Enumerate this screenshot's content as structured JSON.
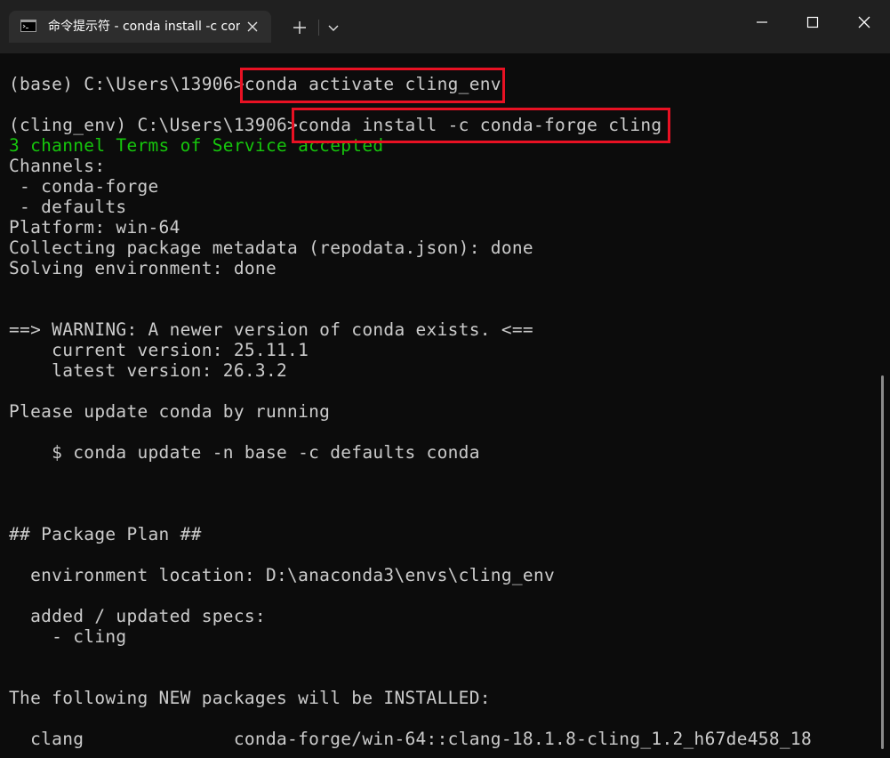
{
  "window": {
    "tab_title": "命令提示符 - conda  install -c conda-forge cling",
    "icons": {
      "tab_icon": "cmd-terminal-icon",
      "tab_close": "close-icon",
      "new_tab": "plus-icon",
      "dropdown": "chevron-down-icon",
      "minimize": "minimize-icon",
      "maximize": "maximize-icon",
      "close": "close-icon"
    }
  },
  "colors": {
    "background": "#0c0c0c",
    "titlebar": "#202020",
    "tab": "#2d2d2d",
    "text": "#cccccc",
    "green": "#16c60c",
    "highlight": "#e81123"
  },
  "terminal": {
    "lines": [
      "(base) C:\\Users\\13906>conda activate cling_env",
      "",
      "(cling_env) C:\\Users\\13906>conda install -c conda-forge cling",
      "3 channel Terms of Service accepted",
      "Channels:",
      " - conda-forge",
      " - defaults",
      "Platform: win-64",
      "Collecting package metadata (repodata.json): done",
      "Solving environment: done",
      "",
      "",
      "==> WARNING: A newer version of conda exists. <==",
      "    current version: 25.11.1",
      "    latest version: 26.3.2",
      "",
      "Please update conda by running",
      "",
      "    $ conda update -n base -c defaults conda",
      "",
      "",
      "",
      "## Package Plan ##",
      "",
      "  environment location: D:\\anaconda3\\envs\\cling_env",
      "",
      "  added / updated specs:",
      "    - cling",
      "",
      "",
      "The following NEW packages will be INSTALLED:",
      "",
      "  clang              conda-forge/win-64::clang-18.1.8-cling_1.2_h67de458_18"
    ]
  }
}
